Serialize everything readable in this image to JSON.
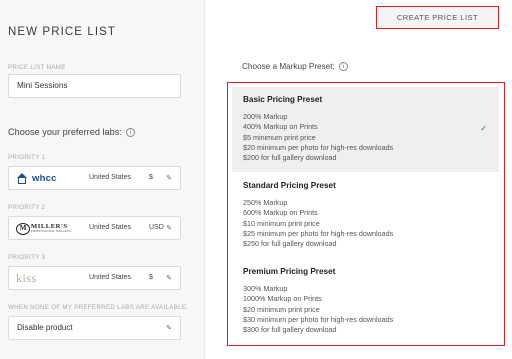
{
  "left_panel": {
    "title": "NEW PRICE LIST",
    "price_list_name_label": "PRICE LIST NAME",
    "price_list_name_value": "Mini Sessions",
    "preferred_labs_heading": "Choose your preferred labs:",
    "priorities": [
      {
        "label": "PRIORITY 1",
        "lab": "whcc",
        "country": "United States",
        "currency": "$"
      },
      {
        "label": "PRIORITY 2",
        "lab_main": "MILLER'S",
        "lab_sub": "PROFESSIONAL IMAGING",
        "lab_badge": "M",
        "country": "United States",
        "currency": "USD"
      },
      {
        "label": "PRIORITY 3",
        "lab": "kiss",
        "country": "United States",
        "currency": "$"
      }
    ],
    "none_available_label": "WHEN NONE OF MY PREFERRED LABS ARE AVAILABLE:",
    "none_available_value": "Disable product"
  },
  "right_panel": {
    "create_button_label": "CREATE PRICE LIST",
    "markup_label": "Choose a Markup Preset:",
    "presets": [
      {
        "title": "Basic Pricing Preset",
        "selected": true,
        "lines": [
          "200% Markup",
          "400% Markup on Prints",
          "$5 minimum print price",
          "$20 minimum per photo for high-res downloads",
          "$200 for full gallery download"
        ]
      },
      {
        "title": "Standard Pricing Preset",
        "selected": false,
        "lines": [
          "250% Markup",
          "600% Markup on Prints",
          "$10 minimum print price",
          "$25 minimum per photo for high-res downloads",
          "$250 for full gallery download"
        ]
      },
      {
        "title": "Premium Pricing Preset",
        "selected": false,
        "lines": [
          "300% Markup",
          "1000% Markup on Prints",
          "$20 minimum print price",
          "$30 minimum per photo for high-res downloads",
          "$300 for full gallery download"
        ]
      }
    ]
  },
  "icons": {
    "info": "info-icon",
    "edit": "pencil-icon",
    "check": "checkmark-icon"
  },
  "colors": {
    "highlight_border": "#e02020",
    "whcc_blue": "#1f4e8c",
    "selected_bg": "#efefef"
  }
}
